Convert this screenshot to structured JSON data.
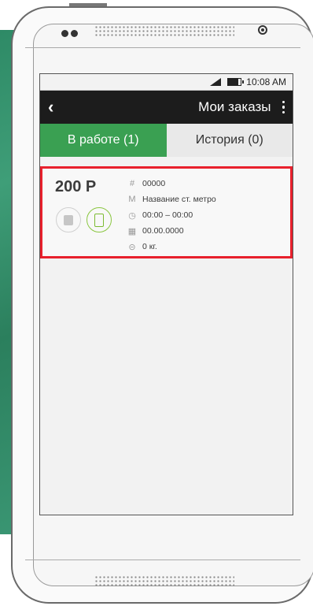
{
  "status_bar": {
    "time": "10:08 AM"
  },
  "app_bar": {
    "back": "‹",
    "title": "Мои заказы"
  },
  "tabs": [
    {
      "label": "В работе (1)",
      "active": true
    },
    {
      "label": "История (0)",
      "active": false
    }
  ],
  "order": {
    "price": "200 Р",
    "number": "00000",
    "metro": "Название ст. метро",
    "time": "00:00 – 00:00",
    "date": "00.00.0000",
    "weight": "0 кг."
  },
  "icons": {
    "hash": "#",
    "metro": "M",
    "timer": "◷",
    "calendar": "▦",
    "weight": "⊝"
  },
  "colors": {
    "accent_green": "#3aa052",
    "highlight_red": "#e8202c",
    "appbar_dark": "#1c1c1c"
  }
}
